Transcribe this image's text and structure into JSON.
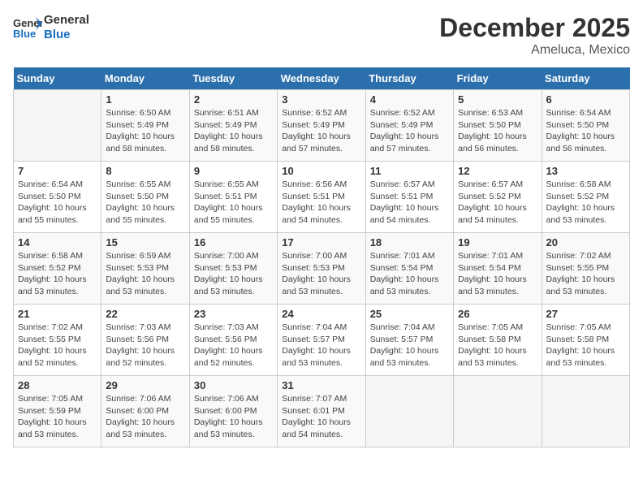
{
  "header": {
    "logo_line1": "General",
    "logo_line2": "Blue",
    "month": "December 2025",
    "location": "Ameluca, Mexico"
  },
  "weekdays": [
    "Sunday",
    "Monday",
    "Tuesday",
    "Wednesday",
    "Thursday",
    "Friday",
    "Saturday"
  ],
  "weeks": [
    [
      {
        "day": "",
        "info": ""
      },
      {
        "day": "1",
        "info": "Sunrise: 6:50 AM\nSunset: 5:49 PM\nDaylight: 10 hours\nand 58 minutes."
      },
      {
        "day": "2",
        "info": "Sunrise: 6:51 AM\nSunset: 5:49 PM\nDaylight: 10 hours\nand 58 minutes."
      },
      {
        "day": "3",
        "info": "Sunrise: 6:52 AM\nSunset: 5:49 PM\nDaylight: 10 hours\nand 57 minutes."
      },
      {
        "day": "4",
        "info": "Sunrise: 6:52 AM\nSunset: 5:49 PM\nDaylight: 10 hours\nand 57 minutes."
      },
      {
        "day": "5",
        "info": "Sunrise: 6:53 AM\nSunset: 5:50 PM\nDaylight: 10 hours\nand 56 minutes."
      },
      {
        "day": "6",
        "info": "Sunrise: 6:54 AM\nSunset: 5:50 PM\nDaylight: 10 hours\nand 56 minutes."
      }
    ],
    [
      {
        "day": "7",
        "info": "Sunrise: 6:54 AM\nSunset: 5:50 PM\nDaylight: 10 hours\nand 55 minutes."
      },
      {
        "day": "8",
        "info": "Sunrise: 6:55 AM\nSunset: 5:50 PM\nDaylight: 10 hours\nand 55 minutes."
      },
      {
        "day": "9",
        "info": "Sunrise: 6:55 AM\nSunset: 5:51 PM\nDaylight: 10 hours\nand 55 minutes."
      },
      {
        "day": "10",
        "info": "Sunrise: 6:56 AM\nSunset: 5:51 PM\nDaylight: 10 hours\nand 54 minutes."
      },
      {
        "day": "11",
        "info": "Sunrise: 6:57 AM\nSunset: 5:51 PM\nDaylight: 10 hours\nand 54 minutes."
      },
      {
        "day": "12",
        "info": "Sunrise: 6:57 AM\nSunset: 5:52 PM\nDaylight: 10 hours\nand 54 minutes."
      },
      {
        "day": "13",
        "info": "Sunrise: 6:58 AM\nSunset: 5:52 PM\nDaylight: 10 hours\nand 53 minutes."
      }
    ],
    [
      {
        "day": "14",
        "info": "Sunrise: 6:58 AM\nSunset: 5:52 PM\nDaylight: 10 hours\nand 53 minutes."
      },
      {
        "day": "15",
        "info": "Sunrise: 6:59 AM\nSunset: 5:53 PM\nDaylight: 10 hours\nand 53 minutes."
      },
      {
        "day": "16",
        "info": "Sunrise: 7:00 AM\nSunset: 5:53 PM\nDaylight: 10 hours\nand 53 minutes."
      },
      {
        "day": "17",
        "info": "Sunrise: 7:00 AM\nSunset: 5:53 PM\nDaylight: 10 hours\nand 53 minutes."
      },
      {
        "day": "18",
        "info": "Sunrise: 7:01 AM\nSunset: 5:54 PM\nDaylight: 10 hours\nand 53 minutes."
      },
      {
        "day": "19",
        "info": "Sunrise: 7:01 AM\nSunset: 5:54 PM\nDaylight: 10 hours\nand 53 minutes."
      },
      {
        "day": "20",
        "info": "Sunrise: 7:02 AM\nSunset: 5:55 PM\nDaylight: 10 hours\nand 53 minutes."
      }
    ],
    [
      {
        "day": "21",
        "info": "Sunrise: 7:02 AM\nSunset: 5:55 PM\nDaylight: 10 hours\nand 52 minutes."
      },
      {
        "day": "22",
        "info": "Sunrise: 7:03 AM\nSunset: 5:56 PM\nDaylight: 10 hours\nand 52 minutes."
      },
      {
        "day": "23",
        "info": "Sunrise: 7:03 AM\nSunset: 5:56 PM\nDaylight: 10 hours\nand 52 minutes."
      },
      {
        "day": "24",
        "info": "Sunrise: 7:04 AM\nSunset: 5:57 PM\nDaylight: 10 hours\nand 53 minutes."
      },
      {
        "day": "25",
        "info": "Sunrise: 7:04 AM\nSunset: 5:57 PM\nDaylight: 10 hours\nand 53 minutes."
      },
      {
        "day": "26",
        "info": "Sunrise: 7:05 AM\nSunset: 5:58 PM\nDaylight: 10 hours\nand 53 minutes."
      },
      {
        "day": "27",
        "info": "Sunrise: 7:05 AM\nSunset: 5:58 PM\nDaylight: 10 hours\nand 53 minutes."
      }
    ],
    [
      {
        "day": "28",
        "info": "Sunrise: 7:05 AM\nSunset: 5:59 PM\nDaylight: 10 hours\nand 53 minutes."
      },
      {
        "day": "29",
        "info": "Sunrise: 7:06 AM\nSunset: 6:00 PM\nDaylight: 10 hours\nand 53 minutes."
      },
      {
        "day": "30",
        "info": "Sunrise: 7:06 AM\nSunset: 6:00 PM\nDaylight: 10 hours\nand 53 minutes."
      },
      {
        "day": "31",
        "info": "Sunrise: 7:07 AM\nSunset: 6:01 PM\nDaylight: 10 hours\nand 54 minutes."
      },
      {
        "day": "",
        "info": ""
      },
      {
        "day": "",
        "info": ""
      },
      {
        "day": "",
        "info": ""
      }
    ]
  ]
}
